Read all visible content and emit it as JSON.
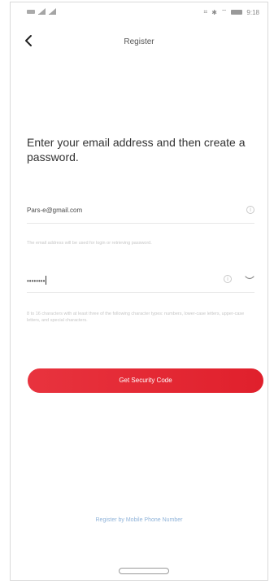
{
  "status_bar": {
    "left_icons": [
      "battery-saver-icon",
      "signal-icon",
      "signal-icon"
    ],
    "right_icons": [
      "network-icon",
      "bluetooth-icon",
      "wifi-icon",
      "battery-icon"
    ],
    "time": "9:18"
  },
  "header": {
    "back_icon": "chevron-left-icon",
    "title": "Register"
  },
  "heading": "Enter your email address and then create a password.",
  "email_field": {
    "value": "Pars-e@gmail.com",
    "info_icon": "info-icon",
    "hint": "The email address will be used for login or retrieving password."
  },
  "password_field": {
    "value": "••••••••",
    "info_icon": "info-icon",
    "visibility_icon": "eye-closed-icon",
    "hint": "8 to 16 characters with at least three of the following character types: numbers, lower-case letters, upper-case letters, and special characters."
  },
  "cta": {
    "label": "Get Security Code",
    "color": "#e4262f"
  },
  "alt_link": "Register by Mobile Phone Number"
}
